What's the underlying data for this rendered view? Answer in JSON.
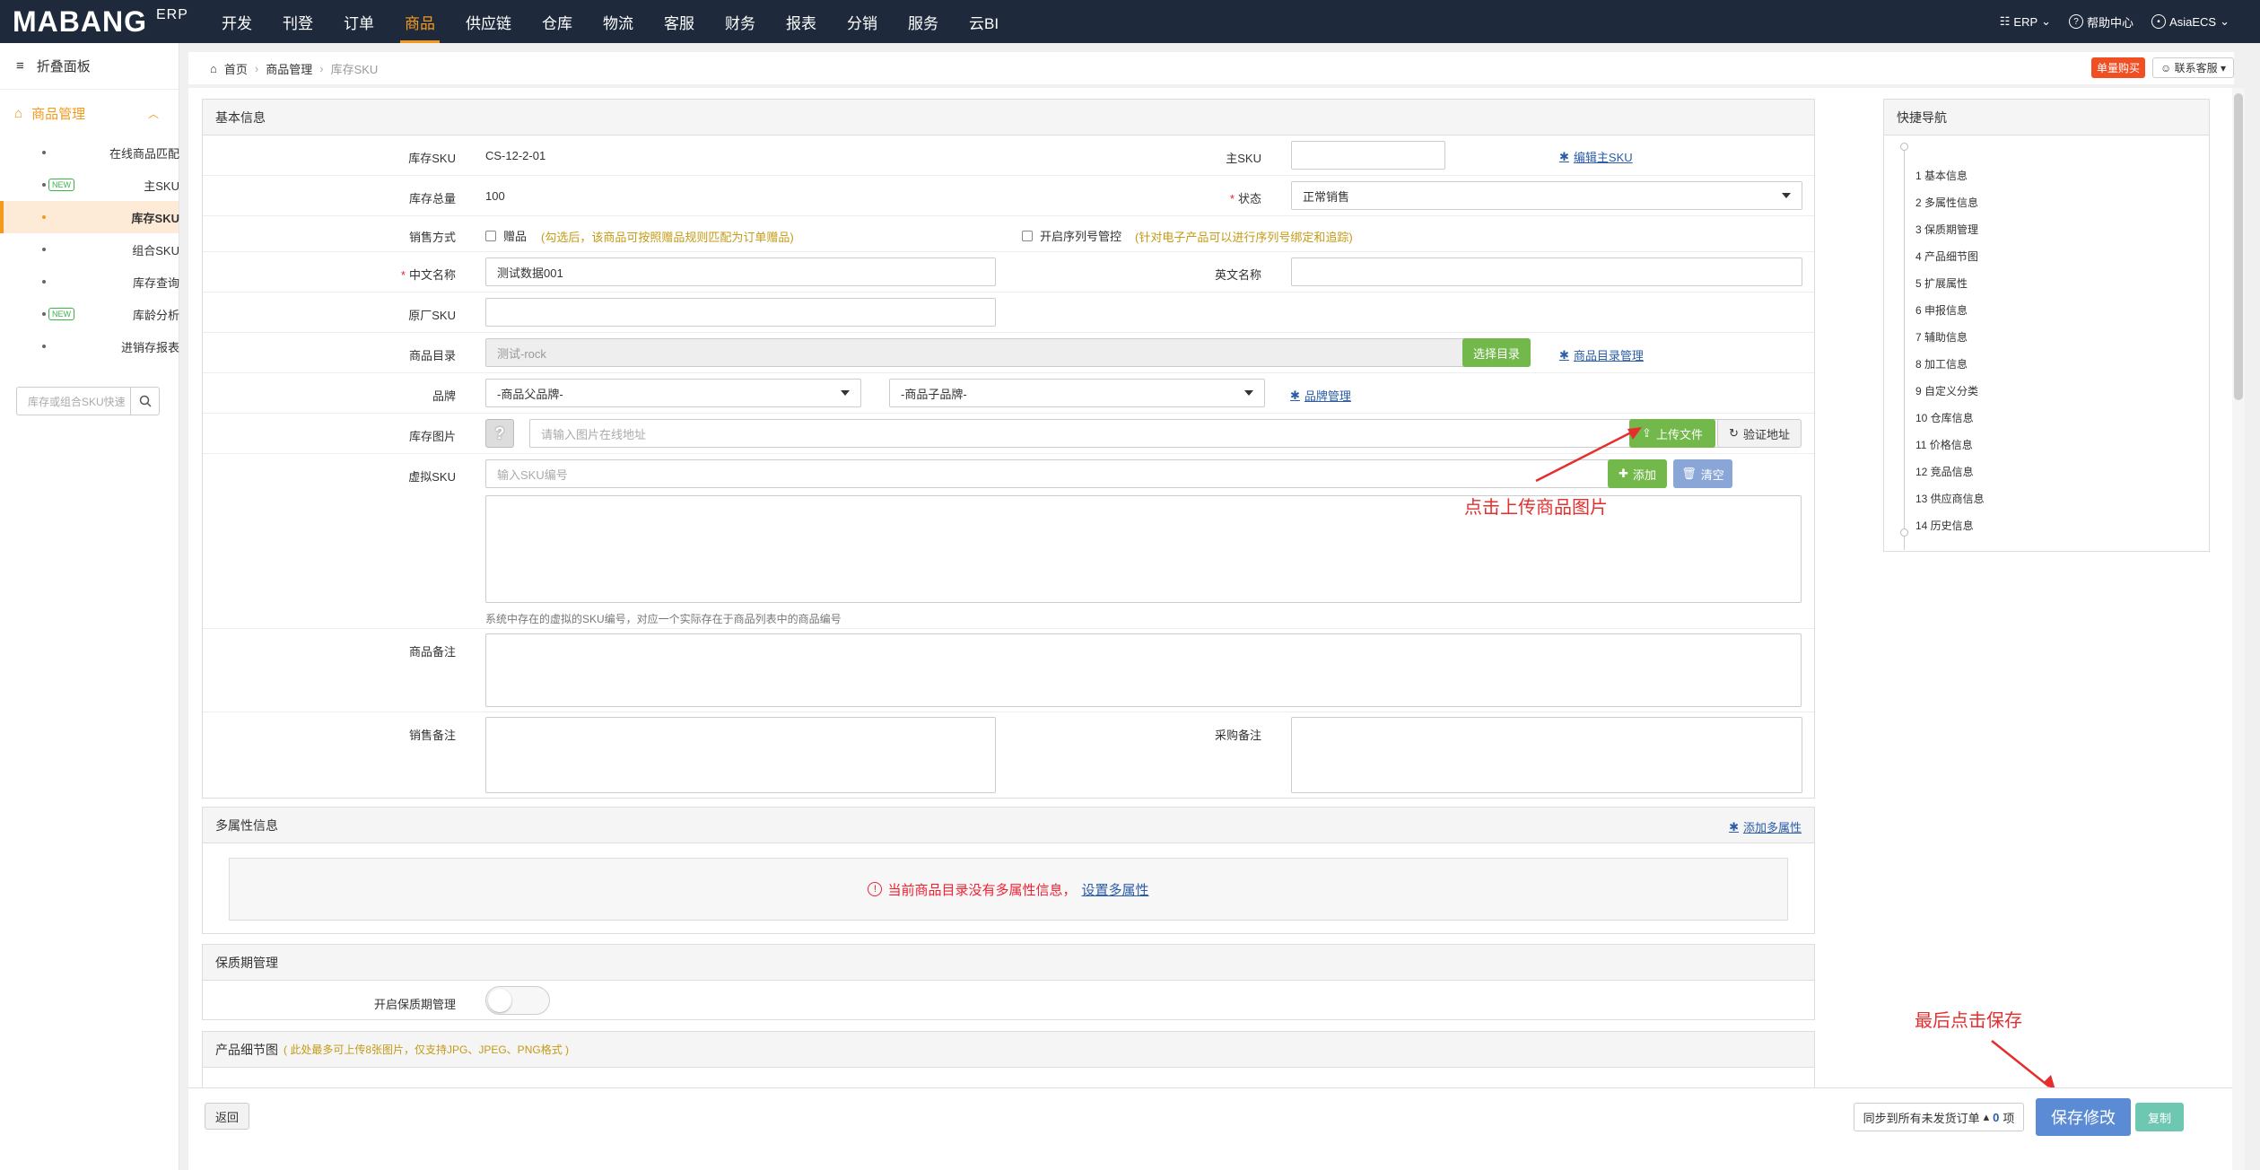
{
  "topbar": {
    "logo": "MABANG",
    "erp": "ERP",
    "nav": [
      "开发",
      "刊登",
      "订单",
      "商品",
      "供应链",
      "仓库",
      "物流",
      "客服",
      "财务",
      "报表",
      "分销",
      "服务",
      "云BI"
    ],
    "active_index": 3,
    "right": {
      "erp": "ERP",
      "help": "帮助中心",
      "user": "AsiaECS"
    }
  },
  "sidebar": {
    "fold": "折叠面板",
    "group": "商品管理",
    "items": [
      "在线商品匹配",
      "主SKU",
      "库存SKU",
      "组合SKU",
      "库存查询",
      "库龄分析",
      "进销存报表"
    ],
    "new_badge": "NEW",
    "active_index": 2,
    "search_placeholder": "库存或组合SKU快速"
  },
  "breadcrumb": {
    "home": "首页",
    "parent": "商品管理",
    "current": "库存SKU",
    "hot": "单量购买",
    "contact": "联系客服"
  },
  "basic": {
    "title": "基本信息",
    "sku_label": "库存SKU",
    "sku_value": "CS-12-2-01",
    "main_sku_label": "主SKU",
    "edit_main_sku": "编辑主SKU",
    "stock_label": "库存总量",
    "stock_value": "100",
    "status_label": "状态",
    "status_value": "正常销售",
    "sales_mode_label": "销售方式",
    "gift_label": "赠品",
    "gift_hint": "(勾选后，该商品可按照赠品规则匹配为订单赠品)",
    "serial_label": "开启序列号管控",
    "serial_hint": "(针对电子产品可以进行序列号绑定和追踪)",
    "cn_name_label": "中文名称",
    "cn_name_value": "测试数据001",
    "en_name_label": "英文名称",
    "factory_sku_label": "原厂SKU",
    "catalog_label": "商品目录",
    "catalog_value": "测试-rock",
    "choose_catalog": "选择目录",
    "catalog_manage": "商品目录管理",
    "brand_label": "品牌",
    "brand_parent": "-商品父品牌-",
    "brand_child": "-商品子品牌-",
    "brand_manage": "品牌管理",
    "image_label": "库存图片",
    "image_placeholder": "请输入图片在线地址",
    "upload": "上传文件",
    "verify": "验证地址",
    "virtual_label": "虚拟SKU",
    "virtual_placeholder": "输入SKU编号",
    "add": "添加",
    "clear": "清空",
    "virtual_note": "系统中存在的虚拟的SKU编号，对应一个实际存在于商品列表中的商品编号",
    "remark_label": "商品备注",
    "sales_remark_label": "销售备注",
    "purchase_remark_label": "采购备注"
  },
  "annotations": {
    "upload": "点击上传商品图片",
    "save": "最后点击保存"
  },
  "multi": {
    "title": "多属性信息",
    "add_link": "添加多属性",
    "empty": "当前商品目录没有多属性信息，",
    "set_link": "设置多属性"
  },
  "shelf": {
    "title": "保质期管理",
    "toggle_label": "开启保质期管理"
  },
  "detail": {
    "title": "产品细节图",
    "hint": "( 此处最多可上传8张图片，仅支持JPG、JPEG、PNG格式 )"
  },
  "quicknav": {
    "title": "快捷导航",
    "items": [
      "1 基本信息",
      "2 多属性信息",
      "3 保质期管理",
      "4 产品细节图",
      "5 扩展属性",
      "6 申报信息",
      "7 辅助信息",
      "8 加工信息",
      "9 自定义分类",
      "10 仓库信息",
      "11 价格信息",
      "12 竞品信息",
      "13 供应商信息",
      "14 历史信息"
    ]
  },
  "bottom": {
    "back": "返回",
    "sync_label": "同步到所有未发货订单",
    "sync_count": "0",
    "sync_unit": "项",
    "save": "保存修改",
    "copy": "复制"
  }
}
